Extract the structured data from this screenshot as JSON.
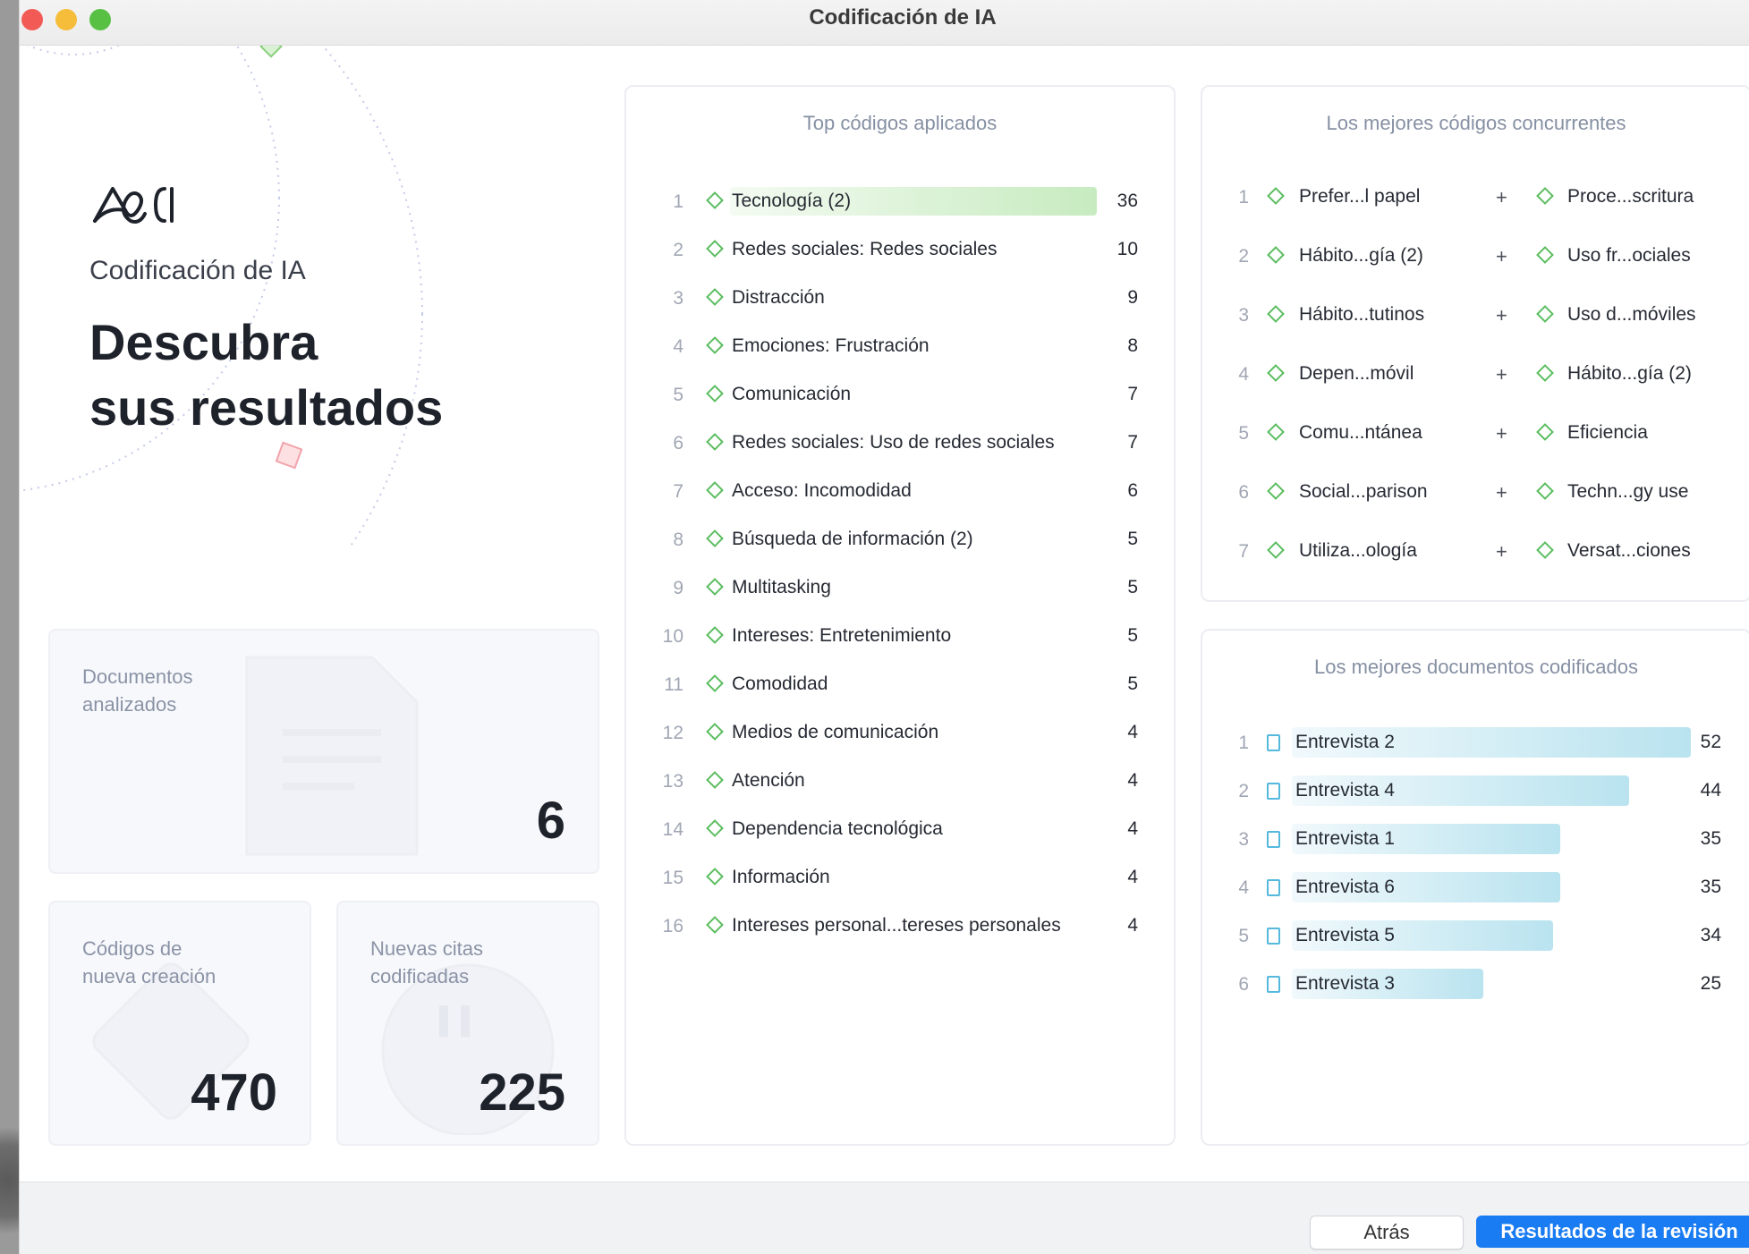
{
  "window": {
    "title": "Codificación de IA"
  },
  "brand": {
    "name": "Codificación de IA",
    "logo": "ai-coding-logo"
  },
  "hero": {
    "line1": "Descubra",
    "line2": "sus resultados"
  },
  "stats": {
    "documents": {
      "label": "Documentos analizados",
      "value": "6"
    },
    "new_codes": {
      "label": "Códigos de nueva creación",
      "value": "470"
    },
    "new_quotes": {
      "label": "Nuevas citas codificadas",
      "value": "225"
    }
  },
  "top_codes": {
    "title": "Top códigos aplicados",
    "items": [
      {
        "rank": "1",
        "label": "Tecnología (2)",
        "count": "36"
      },
      {
        "rank": "2",
        "label": "Redes sociales: Redes sociales",
        "count": "10"
      },
      {
        "rank": "3",
        "label": "Distracción",
        "count": "9"
      },
      {
        "rank": "4",
        "label": "Emociones: Frustración",
        "count": "8"
      },
      {
        "rank": "5",
        "label": "Comunicación",
        "count": "7"
      },
      {
        "rank": "6",
        "label": "Redes sociales: Uso de redes sociales",
        "count": "7"
      },
      {
        "rank": "7",
        "label": "Acceso: Incomodidad",
        "count": "6"
      },
      {
        "rank": "8",
        "label": "Búsqueda de información (2)",
        "count": "5"
      },
      {
        "rank": "9",
        "label": "Multitasking",
        "count": "5"
      },
      {
        "rank": "10",
        "label": "Intereses: Entretenimiento",
        "count": "5"
      },
      {
        "rank": "11",
        "label": "Comodidad",
        "count": "5"
      },
      {
        "rank": "12",
        "label": "Medios de comunicación",
        "count": "4"
      },
      {
        "rank": "13",
        "label": "Atención",
        "count": "4"
      },
      {
        "rank": "14",
        "label": "Dependencia tecnológica",
        "count": "4"
      },
      {
        "rank": "15",
        "label": "Información",
        "count": "4"
      },
      {
        "rank": "16",
        "label": "Intereses personal...tereses personales",
        "count": "4"
      }
    ]
  },
  "cooccurring": {
    "title": "Los mejores códigos concurrentes",
    "plus": "+",
    "items": [
      {
        "rank": "1",
        "a": "Prefer...l papel",
        "b": "Proce...scritura"
      },
      {
        "rank": "2",
        "a": "Hábito...gía (2)",
        "b": "Uso fr...ociales"
      },
      {
        "rank": "3",
        "a": "Hábito...tutinos",
        "b": "Uso d...móviles"
      },
      {
        "rank": "4",
        "a": "Depen...móvil",
        "b": "Hábito...gía (2)"
      },
      {
        "rank": "5",
        "a": "Comu...ntánea",
        "b": "Eficiencia"
      },
      {
        "rank": "6",
        "a": "Social...parison",
        "b": "Techn...gy use"
      },
      {
        "rank": "7",
        "a": "Utiliza...ología",
        "b": "Versat...ciones"
      }
    ]
  },
  "top_documents": {
    "title": "Los mejores documentos codificados",
    "items": [
      {
        "rank": "1",
        "label": "Entrevista 2",
        "count": "52"
      },
      {
        "rank": "2",
        "label": "Entrevista 4",
        "count": "44"
      },
      {
        "rank": "3",
        "label": "Entrevista 1",
        "count": "35"
      },
      {
        "rank": "4",
        "label": "Entrevista 6",
        "count": "35"
      },
      {
        "rank": "5",
        "label": "Entrevista 5",
        "count": "34"
      },
      {
        "rank": "6",
        "label": "Entrevista 3",
        "count": "25"
      }
    ]
  },
  "footer": {
    "back_label": "Atrás",
    "primary_label": "Resultados de la revisión"
  },
  "colors": {
    "accent": "#1a7cf2",
    "code_green": "#5bbd5f",
    "doc_blue": "#55b9de"
  }
}
